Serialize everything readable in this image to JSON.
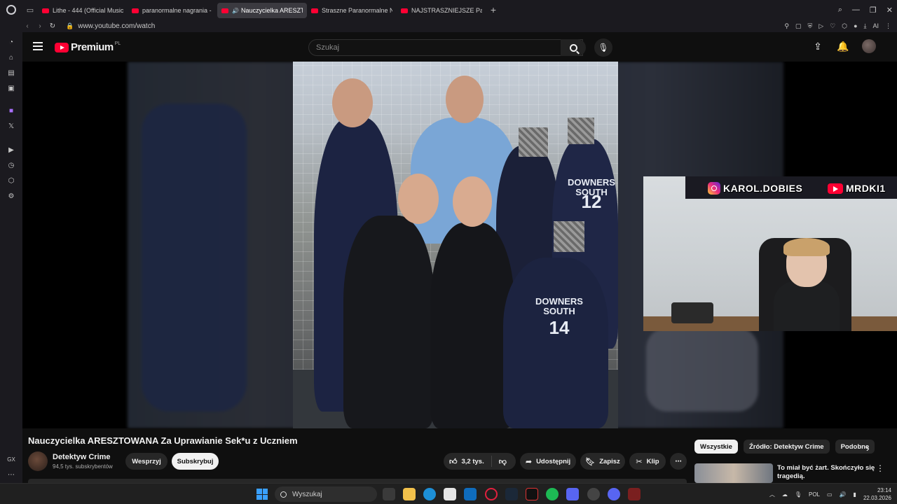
{
  "browser": {
    "tabs": [
      {
        "label": "Lithe - 444 (Official Music"
      },
      {
        "label": "paranormalne nagrania - Y"
      },
      {
        "label": "Nauczycielka ARESZTO",
        "active": true,
        "playing": true
      },
      {
        "label": "Straszne Paranormalne Na"
      },
      {
        "label": "NAJSTRASZNIEJSZE Para"
      }
    ],
    "new_tab": "+",
    "url": "www.youtube.com/watch",
    "ai_label": "AI",
    "gx_label": "GX"
  },
  "youtube": {
    "logo_text": "Premium",
    "logo_badge": "PL",
    "search_placeholder": "Szukaj"
  },
  "overlay": {
    "instagram_handle": "KAROL.DOBIES",
    "youtube_handle": "MRDKI1"
  },
  "photo": {
    "jersey_text_1": "DOWNERS\nSOUTH",
    "jersey_number_1": "12",
    "jersey_text_2": "DOWNERS\nSOUTH",
    "jersey_number_2": "14"
  },
  "video": {
    "title": "Nauczycielka ARESZTOWANA Za Uprawianie Sek*u z Uczniem",
    "channel_name": "Detektyw Crime",
    "subscribers": "94,5 tys. subskrybentów",
    "join_label": "Wesprzyj",
    "subscribe_label": "Subskrybuj",
    "likes": "3,2 tys.",
    "share_label": "Udostępnij",
    "save_label": "Zapisz",
    "clip_label": "Klip",
    "more": "⋯"
  },
  "sidebar_chips": [
    "Wszystkie",
    "Źródło: Detektyw Crime",
    "Podobne"
  ],
  "recommendation": {
    "title": "To miał być żart. Skończyło się tragedią."
  },
  "taskbar": {
    "search_label": "Wyszukaj",
    "language": "POL",
    "time": "23:14",
    "date": "22.03.2026"
  }
}
